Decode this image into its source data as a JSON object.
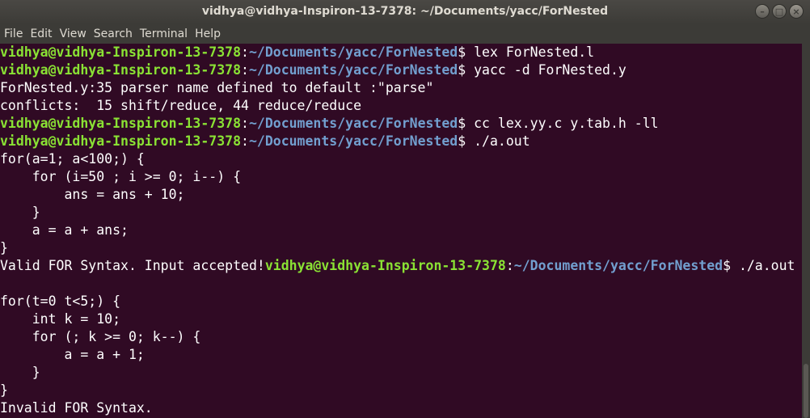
{
  "window": {
    "title": "vidhya@vidhya-Inspiron-13-7378: ~/Documents/yacc/ForNested"
  },
  "menu": [
    "File",
    "Edit",
    "View",
    "Search",
    "Terminal",
    "Help"
  ],
  "prompt": {
    "user": "vidhya@vidhya-Inspiron-13-7378",
    "path": "~/Documents/yacc/ForNested"
  },
  "lines": [
    {
      "type": "prompt",
      "cmd": "lex ForNested.l"
    },
    {
      "type": "prompt",
      "cmd": "yacc -d ForNested.y"
    },
    {
      "type": "out",
      "text": "ForNested.y:35 parser name defined to default :\"parse\""
    },
    {
      "type": "out",
      "text": "conflicts:  15 shift/reduce, 44 reduce/reduce"
    },
    {
      "type": "prompt",
      "cmd": "cc lex.yy.c y.tab.h -ll"
    },
    {
      "type": "prompt",
      "cmd": "./a.out"
    },
    {
      "type": "out",
      "text": "for(a=1; a<100;) {"
    },
    {
      "type": "out",
      "text": "    for (i=50 ; i >= 0; i--) {"
    },
    {
      "type": "out",
      "text": "        ans = ans + 10;"
    },
    {
      "type": "out",
      "text": "    }"
    },
    {
      "type": "out",
      "text": "    a = a + ans;"
    },
    {
      "type": "out",
      "text": "}"
    },
    {
      "type": "mixed",
      "text": "Valid FOR Syntax. Input accepted!",
      "cmd": "./a.out"
    },
    {
      "type": "out",
      "text": ""
    },
    {
      "type": "out",
      "text": "for(t=0 t<5;) {"
    },
    {
      "type": "out",
      "text": "    int k = 10;"
    },
    {
      "type": "out",
      "text": "    for (; k >= 0; k--) {"
    },
    {
      "type": "out",
      "text": "        a = a + 1;"
    },
    {
      "type": "out",
      "text": "    }"
    },
    {
      "type": "out",
      "text": "}"
    },
    {
      "type": "out",
      "text": "Invalid FOR Syntax."
    }
  ]
}
